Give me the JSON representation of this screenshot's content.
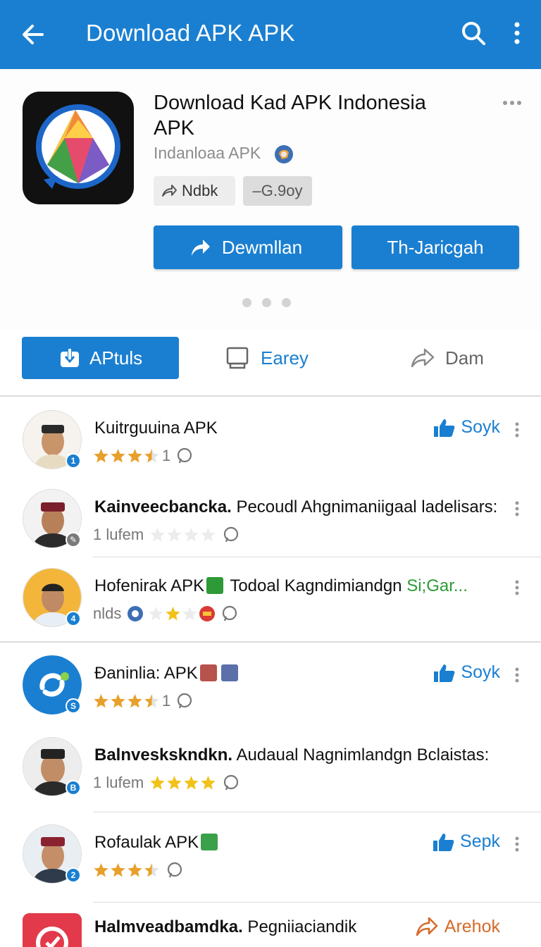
{
  "appbar": {
    "title": "Download APK APK",
    "back_icon": "arrow-left-icon",
    "search_icon": "search-icon",
    "menu_icon": "more-vertical-icon"
  },
  "app": {
    "name": "Download Kad APK Indonesia APK",
    "developer": "Indanloaa APK",
    "chips": [
      "Ndbk",
      "–G.9oy"
    ],
    "primary_button": "Dewmllan",
    "secondary_button": "Th-Jaricgah"
  },
  "tabs": [
    {
      "label": "APtuls",
      "icon": "app-download-icon",
      "active": true
    },
    {
      "label": "Earey",
      "icon": "monitor-icon",
      "active": false
    },
    {
      "label": "Dam",
      "icon": "share-icon",
      "active": false
    }
  ],
  "list": [
    {
      "title": "Kuitrguuina APK",
      "rating": 3.5,
      "count": "1",
      "action": "Soyk",
      "badge": "1"
    },
    {
      "title_bold": "Kainveecbancka.",
      "title_rest": " Pecoudl Ahgnimaniigaal ladelisars:",
      "meta_text": "1 lufem",
      "rating": 0,
      "badge": ""
    },
    {
      "title_bold": "Hofenirak APK",
      "title_rest": " Todoal Kagndimiandgn ",
      "title_green": "Si;Gar...",
      "meta_text": "nlds",
      "rating": 2,
      "badge": "4"
    },
    {
      "title": "Đaninlia: APK",
      "rating": 3.5,
      "count": "1",
      "action": "Soyk",
      "badge": "S"
    },
    {
      "title_bold": "Balnveskskndkn.",
      "title_rest": " Audaual Nagnimlandgn  Bclaistas:",
      "meta_text": "1 lufem",
      "rating": 4,
      "badge": "B"
    },
    {
      "title": "Rofaulak APK",
      "rating": 3.5,
      "count": "",
      "action": "Sepk",
      "badge": "2"
    },
    {
      "title_bold": "Halmveadbamdka.",
      "title_rest": " Pegniiaciandik",
      "action": "Arehok"
    }
  ],
  "colors": {
    "primary": "#1a7fd1",
    "star": "#e8a02c",
    "green": "#2e9a37",
    "orange": "#d56b2c"
  }
}
